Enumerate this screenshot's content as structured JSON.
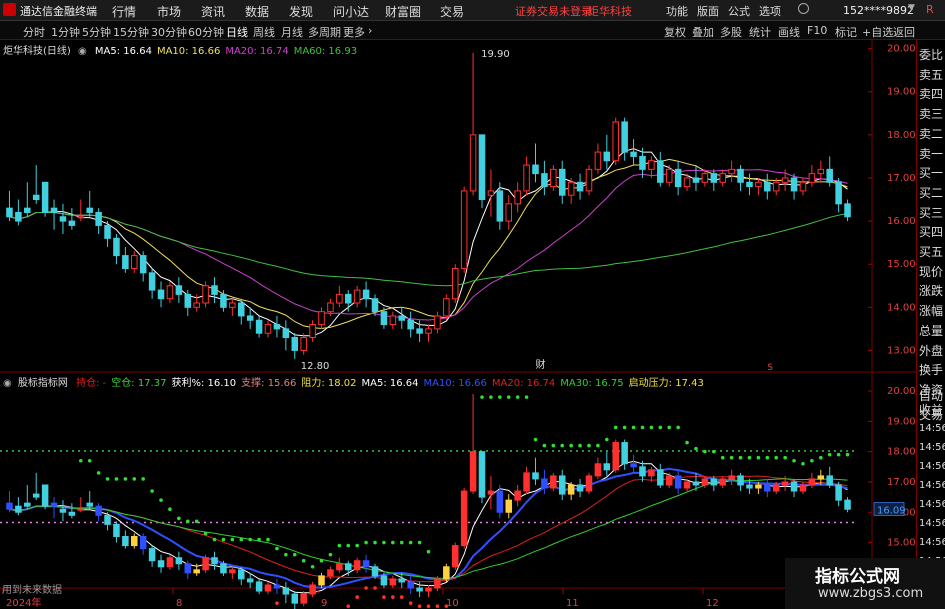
{
  "app": {
    "title": "通达信金融终端",
    "menus": [
      "行情",
      "市场",
      "资讯",
      "数据",
      "发现",
      "问小达",
      "财富圈",
      "交易"
    ],
    "warning": "证券交易未登录",
    "stock_short": "炬华科技",
    "right_menus": [
      "功能",
      "版面",
      "公式",
      "选项"
    ],
    "user": "152****9892",
    "red_tag": "R"
  },
  "toolbar": {
    "periods": [
      "分时",
      "1分钟",
      "5分钟",
      "15分钟",
      "30分钟",
      "60分钟",
      "日线",
      "周线",
      "月线",
      "多周期",
      "更多"
    ],
    "active_period": "日线",
    "right_buttons": [
      "复权",
      "叠加",
      "多股",
      "统计",
      "画线",
      "F10",
      "+自选",
      "返回"
    ]
  },
  "right_panel": {
    "labels": [
      "委比",
      "卖五",
      "卖四",
      "卖三",
      "卖二",
      "卖一",
      "买一",
      "买二",
      "买三",
      "买四",
      "买五",
      "现价",
      "涨跌",
      "涨幅",
      "总量",
      "外盘",
      "换手",
      "净资",
      "收益",
      "自动",
      "交易"
    ],
    "times": [
      "14:56",
      "14:56",
      "14:56",
      "14:56",
      "14:56",
      "14:56",
      "14:56",
      "14:56"
    ]
  },
  "main_panel": {
    "title": "炬华科技(日线)",
    "legend": [
      {
        "label": "MA5: 16.64",
        "color": "#ffffff"
      },
      {
        "label": "MA10: 16.66",
        "color": "#f0e060"
      },
      {
        "label": "MA20: 16.74",
        "color": "#d040d0"
      },
      {
        "label": "MA60: 16.93",
        "color": "#40c040"
      }
    ],
    "high_label": "19.90",
    "low_label": "12.80",
    "cai_label": "财",
    "s_label": "S"
  },
  "sub_panel": {
    "title": "股标指标网",
    "legend": [
      {
        "label": "持仓: -",
        "color": "#e02020"
      },
      {
        "label": "空仓: 17.37",
        "color": "#40d040"
      },
      {
        "label": "获利%: 16.10",
        "color": "#ffffff"
      },
      {
        "label": "支撑: 15.66",
        "color": "#e08080"
      },
      {
        "label": "阻力: 18.02",
        "color": "#f0e040"
      },
      {
        "label": "MA5: 16.64",
        "color": "#ffffff"
      },
      {
        "label": "MA10: 16.66",
        "color": "#3050ff"
      },
      {
        "label": "MA20: 16.74",
        "color": "#e02020"
      },
      {
        "label": "MA30: 16.75",
        "color": "#30d030"
      },
      {
        "label": "启动压力: 17.43",
        "color": "#f0e040"
      }
    ],
    "price_tag": "16.09",
    "footer": "用到未来数据"
  },
  "bottom_axis": {
    "labels": [
      {
        "text": "2024年",
        "x": 3
      },
      {
        "text": "8",
        "x": 173
      },
      {
        "text": "9",
        "x": 318
      },
      {
        "text": "10",
        "x": 443
      },
      {
        "text": "11",
        "x": 563
      },
      {
        "text": "12",
        "x": 703
      }
    ]
  },
  "watermark": {
    "title": "指标公式网",
    "url": "www.zbgs3.com"
  },
  "chart_data": {
    "type": "candlestick",
    "yaxis_main": {
      "ticks": [
        20.0,
        19.0,
        18.0,
        17.0,
        16.0,
        15.0,
        14.0,
        13.0
      ],
      "ylim": [
        12.5,
        20.2
      ]
    },
    "yaxis_sub": {
      "ticks": [
        20.0,
        19.0,
        18.0,
        17.0,
        16.0,
        15.0,
        14.0
      ],
      "ylim": [
        13.5,
        20.2
      ]
    },
    "candles": [
      [
        16.3,
        16.7,
        16.1,
        16.0
      ],
      [
        16.2,
        16.5,
        16.0,
        15.9
      ],
      [
        16.3,
        16.9,
        16.2,
        16.1
      ],
      [
        16.6,
        17.3,
        16.5,
        16.4
      ],
      [
        16.9,
        16.9,
        16.2,
        16.1
      ],
      [
        16.3,
        16.5,
        16.2,
        15.8
      ],
      [
        16.1,
        16.4,
        16.0,
        15.7
      ],
      [
        16.0,
        16.3,
        15.9,
        15.8
      ],
      [
        16.1,
        16.5,
        16.1,
        16.0
      ],
      [
        16.3,
        16.7,
        16.2,
        16.1
      ],
      [
        16.2,
        16.3,
        15.9,
        15.7
      ],
      [
        15.9,
        16.0,
        15.6,
        15.4
      ],
      [
        15.6,
        15.7,
        15.2,
        15.0
      ],
      [
        15.2,
        15.4,
        14.9,
        14.8
      ],
      [
        14.9,
        15.3,
        15.2,
        14.8
      ],
      [
        15.2,
        15.3,
        14.8,
        14.6
      ],
      [
        14.8,
        14.9,
        14.4,
        14.2
      ],
      [
        14.4,
        14.6,
        14.2,
        14.0
      ],
      [
        14.2,
        14.6,
        14.5,
        14.1
      ],
      [
        14.5,
        14.7,
        14.3,
        14.1
      ],
      [
        14.3,
        14.4,
        14.0,
        13.8
      ],
      [
        14.0,
        14.3,
        14.1,
        13.9
      ],
      [
        14.1,
        14.6,
        14.5,
        14.0
      ],
      [
        14.5,
        14.7,
        14.3,
        14.1
      ],
      [
        14.3,
        14.4,
        14.0,
        13.9
      ],
      [
        14.0,
        14.2,
        14.1,
        13.8
      ],
      [
        14.1,
        14.2,
        13.8,
        13.6
      ],
      [
        13.8,
        14.0,
        13.7,
        13.5
      ],
      [
        13.7,
        13.8,
        13.4,
        13.3
      ],
      [
        13.4,
        13.7,
        13.6,
        13.3
      ],
      [
        13.6,
        13.8,
        13.5,
        13.3
      ],
      [
        13.5,
        13.7,
        13.3,
        13.0
      ],
      [
        13.3,
        13.4,
        13.0,
        12.8
      ],
      [
        13.0,
        13.4,
        13.3,
        12.9
      ],
      [
        13.3,
        13.7,
        13.6,
        13.2
      ],
      [
        13.6,
        14.0,
        13.9,
        13.5
      ],
      [
        13.9,
        14.2,
        14.1,
        13.8
      ],
      [
        14.1,
        14.5,
        14.3,
        14.0
      ],
      [
        14.3,
        14.4,
        14.1,
        13.9
      ],
      [
        14.1,
        14.5,
        14.4,
        14.0
      ],
      [
        14.4,
        14.6,
        14.2,
        14.0
      ],
      [
        14.2,
        14.3,
        13.9,
        13.8
      ],
      [
        13.9,
        14.0,
        13.6,
        13.5
      ],
      [
        13.6,
        13.9,
        13.8,
        13.5
      ],
      [
        13.8,
        14.0,
        13.7,
        13.5
      ],
      [
        13.7,
        13.9,
        13.5,
        13.3
      ],
      [
        13.5,
        13.7,
        13.4,
        13.2
      ],
      [
        13.4,
        13.6,
        13.5,
        13.2
      ],
      [
        13.5,
        13.9,
        13.8,
        13.4
      ],
      [
        13.8,
        14.3,
        14.2,
        13.7
      ],
      [
        14.2,
        15.0,
        14.9,
        14.1
      ],
      [
        14.9,
        16.8,
        16.7,
        14.8
      ],
      [
        16.7,
        19.9,
        18.0,
        16.6
      ],
      [
        18.0,
        18.0,
        16.5,
        16.3
      ],
      [
        16.6,
        17.2,
        16.7,
        16.1
      ],
      [
        16.7,
        16.9,
        16.0,
        15.8
      ],
      [
        16.0,
        16.6,
        16.4,
        15.8
      ],
      [
        16.4,
        16.9,
        16.7,
        16.2
      ],
      [
        16.7,
        17.5,
        17.3,
        16.6
      ],
      [
        17.3,
        17.8,
        17.1,
        16.9
      ],
      [
        17.1,
        17.4,
        16.8,
        16.6
      ],
      [
        16.8,
        17.3,
        17.2,
        16.7
      ],
      [
        17.2,
        17.4,
        16.6,
        16.4
      ],
      [
        16.6,
        17.0,
        16.9,
        16.4
      ],
      [
        16.9,
        17.1,
        16.7,
        16.5
      ],
      [
        16.7,
        17.3,
        17.2,
        16.6
      ],
      [
        17.2,
        17.8,
        17.6,
        17.1
      ],
      [
        17.6,
        18.0,
        17.4,
        17.2
      ],
      [
        17.4,
        18.4,
        18.3,
        17.3
      ],
      [
        18.3,
        18.4,
        17.6,
        17.4
      ],
      [
        17.6,
        17.9,
        17.5,
        17.3
      ],
      [
        17.5,
        17.7,
        17.2,
        17.0
      ],
      [
        17.2,
        17.5,
        17.4,
        17.0
      ],
      [
        17.4,
        17.6,
        16.9,
        16.8
      ],
      [
        16.9,
        17.3,
        17.2,
        16.8
      ],
      [
        17.2,
        17.4,
        16.8,
        16.6
      ],
      [
        16.8,
        17.1,
        17.0,
        16.7
      ],
      [
        17.0,
        17.3,
        16.9,
        16.7
      ],
      [
        16.9,
        17.2,
        17.1,
        16.8
      ],
      [
        17.1,
        17.2,
        16.9,
        16.7
      ],
      [
        16.9,
        17.2,
        17.1,
        16.8
      ],
      [
        17.1,
        17.4,
        17.2,
        16.9
      ],
      [
        17.2,
        17.3,
        16.9,
        16.7
      ],
      [
        16.9,
        17.1,
        16.8,
        16.6
      ],
      [
        16.8,
        17.0,
        16.9,
        16.6
      ],
      [
        16.9,
        17.1,
        16.7,
        16.5
      ],
      [
        16.7,
        17.0,
        16.9,
        16.6
      ],
      [
        16.9,
        17.2,
        17.0,
        16.7
      ],
      [
        17.0,
        17.1,
        16.7,
        16.5
      ],
      [
        16.7,
        17.0,
        16.9,
        16.6
      ],
      [
        16.9,
        17.3,
        17.1,
        16.8
      ],
      [
        17.1,
        17.4,
        17.2,
        16.9
      ],
      [
        17.2,
        17.5,
        16.9,
        16.8
      ],
      [
        16.9,
        17.0,
        16.4,
        16.2
      ],
      [
        16.4,
        16.5,
        16.1,
        16.0
      ]
    ],
    "ma_series": [
      {
        "name": "MA5",
        "color": "#ffffff"
      },
      {
        "name": "MA10",
        "color": "#f0e060"
      },
      {
        "name": "MA20",
        "color": "#d040d0"
      },
      {
        "name": "MA60",
        "color": "#40c040"
      }
    ],
    "reference_lines": [
      {
        "name": "阻力",
        "value": 18.02,
        "color": "#30d030"
      },
      {
        "name": "支撑",
        "value": 15.66,
        "color": "#e080e0"
      }
    ]
  }
}
